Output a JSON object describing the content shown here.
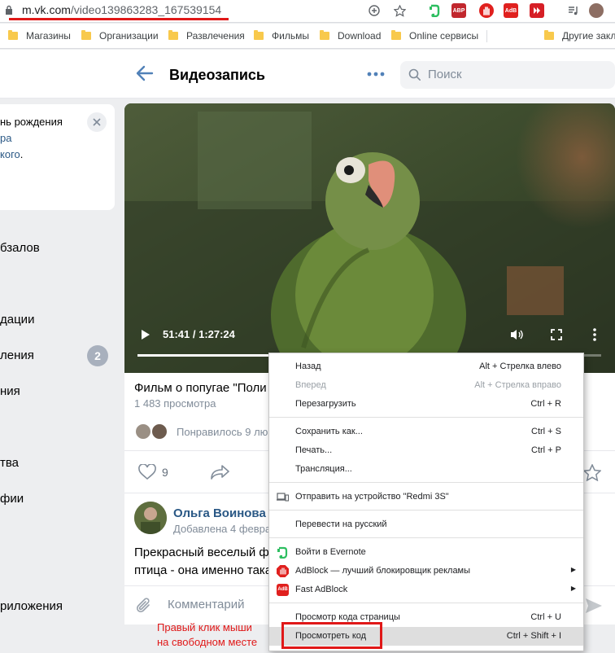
{
  "browser": {
    "url_host": "m.vk.com",
    "url_path": "/video139863283_167539154",
    "bookmarks": [
      "Магазины",
      "Организации",
      "Развлечения",
      "Фильмы",
      "Download",
      "Online сервисы",
      "Другие закл"
    ],
    "ext_labels": {
      "abp": "ABP",
      "adb": "AdB"
    }
  },
  "header": {
    "title": "Видеозапись",
    "search_placeholder": "Поиск"
  },
  "left": {
    "notice_line1": "нь рождения",
    "notice_link1": "ра",
    "notice_link2": "кого",
    "notice_dot": ".",
    "menu": [
      "бзалов",
      "дации",
      "ления",
      "ния",
      "тва",
      "фии",
      "риложения"
    ],
    "badge": "2"
  },
  "video": {
    "time": "51:41 / 1:27:24",
    "progress": 0.593,
    "title": "Фильм о попугае \"Поли",
    "views": "1 483 просмотра",
    "liked_text": "Понравилось 9 лю",
    "like_count": "9"
  },
  "comment": {
    "author": "Ольга Воинова",
    "date": "Добавлена 4 феврa",
    "text_line1": "Прекрасный веселый фи",
    "text_line2": "птица - она именно така",
    "input_placeholder": "Комментарий"
  },
  "context_menu": [
    {
      "label": "Назад",
      "shortcut": "Alt + Стрелка влево",
      "disabled": false
    },
    {
      "label": "Вперед",
      "shortcut": "Alt + Стрелка вправо",
      "disabled": true
    },
    {
      "label": "Перезагрузить",
      "shortcut": "Ctrl + R",
      "disabled": false
    },
    {
      "label": "Сохранить как...",
      "shortcut": "Ctrl + S",
      "disabled": false
    },
    {
      "label": "Печать...",
      "shortcut": "Ctrl + P",
      "disabled": false
    },
    {
      "label": "Трансляция...",
      "shortcut": "",
      "disabled": false
    },
    {
      "label": "Отправить на устройство \"Redmi 3S\"",
      "shortcut": "",
      "disabled": false
    },
    {
      "label": "Перевести на русский",
      "shortcut": "",
      "disabled": false
    },
    {
      "label": "Войти в Evernote",
      "shortcut": "",
      "disabled": false
    },
    {
      "label": "AdBlock — лучший блокировщик рекламы",
      "shortcut": "",
      "disabled": false
    },
    {
      "label": "Fast AdBlock",
      "shortcut": "",
      "disabled": false
    },
    {
      "label": "Просмотр кода страницы",
      "shortcut": "Ctrl + U",
      "disabled": false
    },
    {
      "label": "Просмотреть код",
      "shortcut": "Ctrl + Shift + I",
      "disabled": false
    }
  ],
  "annotation": {
    "line1": "Правый клик мыши",
    "line2": "на свободном месте"
  },
  "colors": {
    "accent": "#e01818",
    "link": "#2a5885",
    "vk_blue": "#5181b8"
  }
}
